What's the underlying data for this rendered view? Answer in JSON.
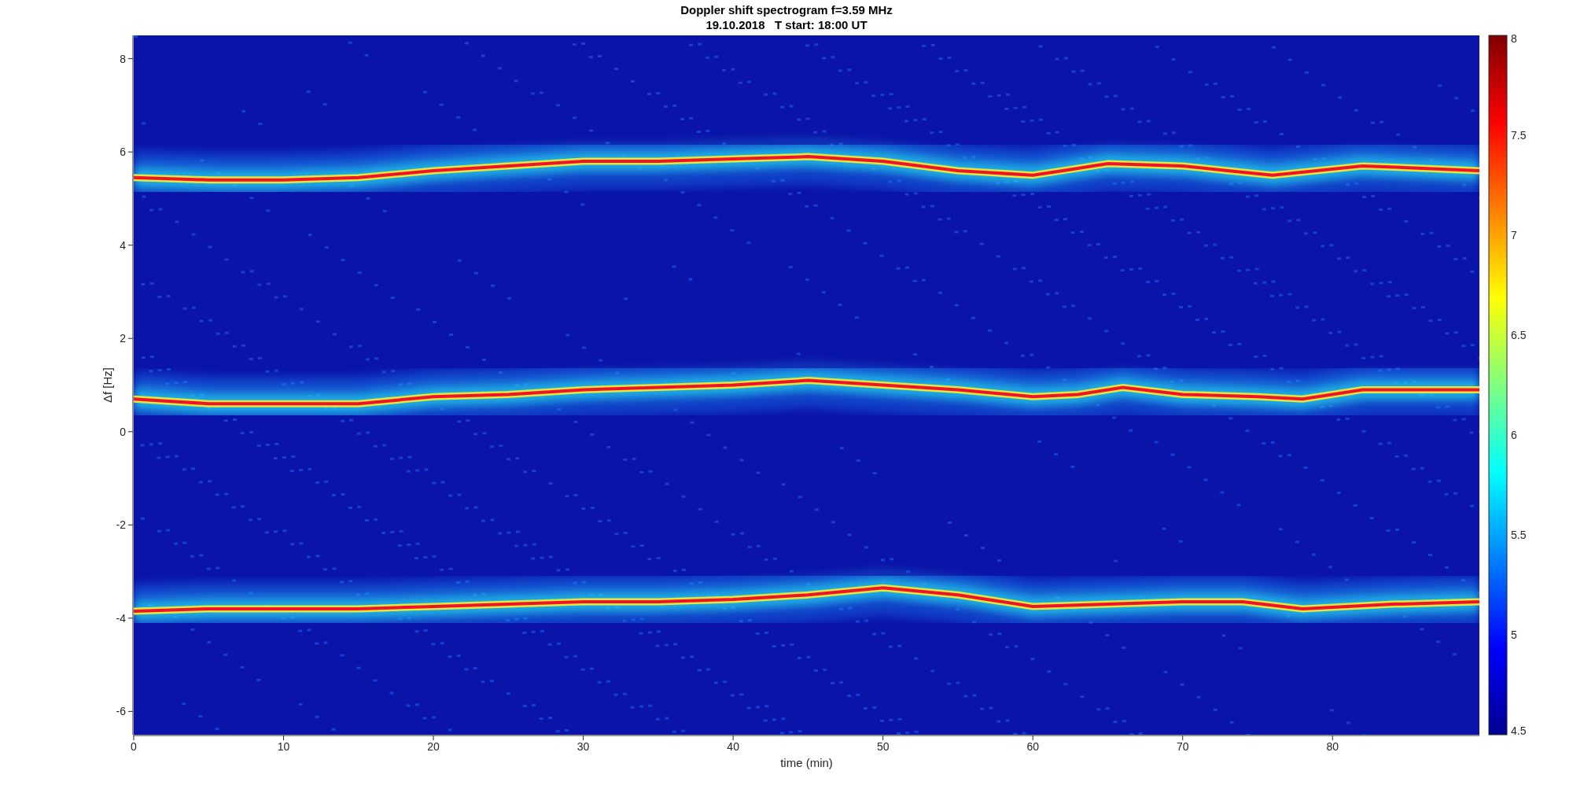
{
  "figure": {
    "title": "Doppler shift spectrogram f=3.59 MHz",
    "subtitle": "19.10.2018   T start: 18:00 UT",
    "xlabel": "time (min)",
    "ylabel": "Δf [Hz]",
    "xticks": [
      "0",
      "10",
      "20",
      "30",
      "40",
      "50",
      "60",
      "70",
      "80"
    ],
    "yticks": [
      "8",
      "6",
      "4",
      "2",
      "0",
      "-2",
      "-4",
      "-6"
    ],
    "colorbar_ticks": [
      "8",
      "7.5",
      "7",
      "6.5",
      "6",
      "5.5",
      "5",
      "4.5"
    ]
  }
}
